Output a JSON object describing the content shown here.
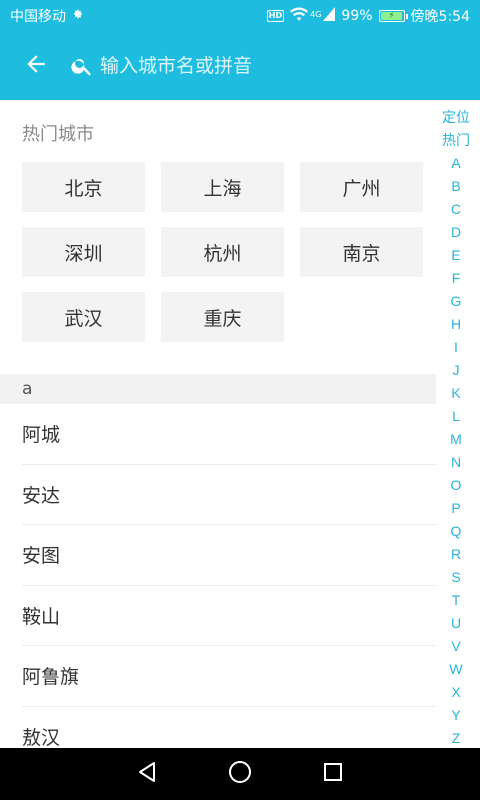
{
  "status_bar": {
    "carrier": "中国移动",
    "network": "4G",
    "battery_pct": "99%",
    "battery_level": 0.99,
    "time": "傍晚5:54",
    "hd_badge": "HD"
  },
  "app_bar": {
    "search_placeholder": "输入城市名或拼音",
    "icons": {
      "back": "arrow-left-icon",
      "search": "search-icon"
    }
  },
  "hot_cities": {
    "title": "热门城市",
    "items": [
      "北京",
      "上海",
      "广州",
      "深圳",
      "杭州",
      "南京",
      "武汉",
      "重庆"
    ]
  },
  "city_section": {
    "header": "a",
    "items": [
      "阿城",
      "安达",
      "安图",
      "鞍山",
      "阿鲁旗",
      "敖汉"
    ]
  },
  "index_bar": {
    "items": [
      "定位",
      "热门",
      "A",
      "B",
      "C",
      "D",
      "E",
      "F",
      "G",
      "H",
      "I",
      "J",
      "K",
      "L",
      "M",
      "N",
      "O",
      "P",
      "Q",
      "R",
      "S",
      "T",
      "U",
      "V",
      "W",
      "X",
      "Y",
      "Z"
    ]
  },
  "colors": {
    "accent": "#1ebde0",
    "index_text": "#27b4d8"
  }
}
